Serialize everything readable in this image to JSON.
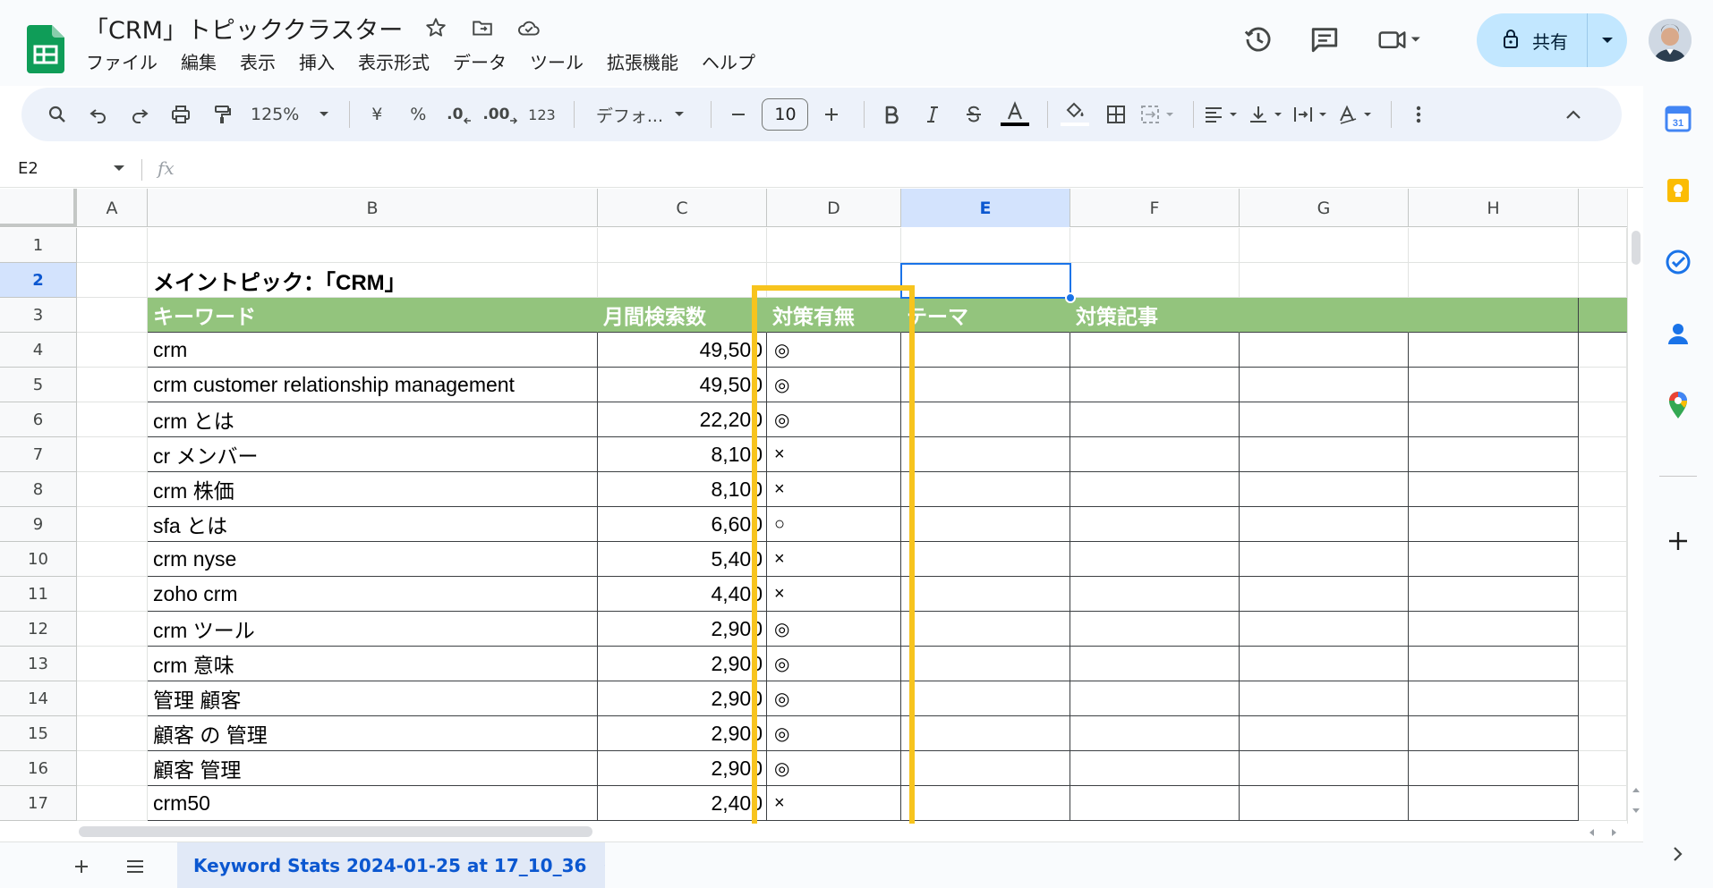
{
  "app": {
    "doc_title": "「CRM」トピッククラスター",
    "menu": [
      "ファイル",
      "編集",
      "表示",
      "挿入",
      "表示形式",
      "データ",
      "ツール",
      "拡張機能",
      "ヘルプ"
    ],
    "share_label": "共有",
    "brand_color": "#0f9d58"
  },
  "toolbar": {
    "zoom": "125%",
    "currency": "¥",
    "percent": "%",
    "dec_decrease": ".0",
    "dec_increase": ".00",
    "number_format": "123",
    "font": "デフォ...",
    "font_size": "10"
  },
  "formula_bar": {
    "cell_ref": "E2",
    "fx": "fx",
    "content": ""
  },
  "grid": {
    "columns": [
      "A",
      "B",
      "C",
      "D",
      "E",
      "F",
      "G",
      "H"
    ],
    "active_column": "E",
    "rows": [
      "1",
      "2",
      "3",
      "4",
      "5",
      "6",
      "7",
      "8",
      "9",
      "10",
      "11",
      "12",
      "13",
      "14",
      "15",
      "16",
      "17"
    ],
    "active_row": "2",
    "title_cell": "メイントピック：「CRM」",
    "headers": {
      "keyword": "キーワード",
      "volume": "月間検索数",
      "status": "対策有無",
      "theme": "テーマ",
      "article": "対策記事"
    },
    "header_color": "#93c47d",
    "highlight_color": "#f7c41e",
    "data": [
      {
        "keyword": "crm",
        "volume": "49,500",
        "status": "◎"
      },
      {
        "keyword": "crm customer relationship management",
        "volume": "49,500",
        "status": "◎"
      },
      {
        "keyword": "crm とは",
        "volume": "22,200",
        "status": "◎"
      },
      {
        "keyword": "cr メンバー",
        "volume": "8,100",
        "status": "×"
      },
      {
        "keyword": "crm 株価",
        "volume": "8,100",
        "status": "×"
      },
      {
        "keyword": "sfa とは",
        "volume": "6,600",
        "status": "○"
      },
      {
        "keyword": "crm nyse",
        "volume": "5,400",
        "status": "×"
      },
      {
        "keyword": "zoho crm",
        "volume": "4,400",
        "status": "×"
      },
      {
        "keyword": "crm ツール",
        "volume": "2,900",
        "status": "◎"
      },
      {
        "keyword": "crm 意味",
        "volume": "2,900",
        "status": "◎"
      },
      {
        "keyword": "管理 顧客",
        "volume": "2,900",
        "status": "◎"
      },
      {
        "keyword": "顧客 の 管理",
        "volume": "2,900",
        "status": "◎"
      },
      {
        "keyword": "顧客 管理",
        "volume": "2,900",
        "status": "◎"
      },
      {
        "keyword": "crm50",
        "volume": "2,400",
        "status": "×"
      }
    ]
  },
  "sheets": {
    "active_tab": "Keyword Stats 2024-01-25 at 17_10_36"
  },
  "side_panel": {
    "calendar_day": "31"
  }
}
